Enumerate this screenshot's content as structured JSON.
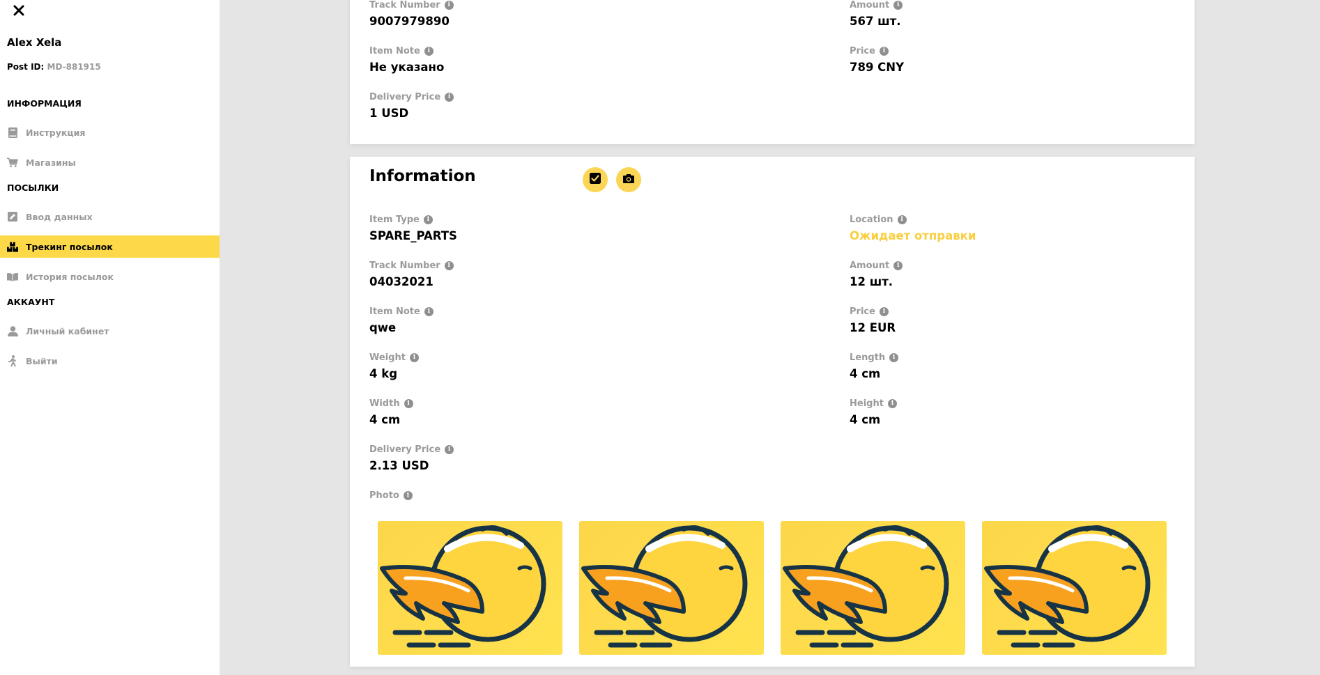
{
  "sidebar": {
    "close_icon": "close-icon",
    "user_name": "Alex Xela",
    "post_id_label": "Post ID:",
    "post_id_value": "MD-881915",
    "sections": {
      "info": "ИНФОРМАЦИЯ",
      "parcels": "ПОСЫЛКИ",
      "account": "АККАУНТ"
    },
    "items": {
      "instruction": {
        "label": "Инструкция",
        "icon": "book-icon"
      },
      "shops": {
        "label": "Магазины",
        "icon": "cart-icon"
      },
      "data_entry": {
        "label": "Ввод данных",
        "icon": "edit-icon"
      },
      "tracking": {
        "label": "Трекинг посылок",
        "icon": "boxes-icon",
        "active": true
      },
      "history": {
        "label": "История посылок",
        "icon": "open-book-icon"
      },
      "profile": {
        "label": "Личный кабинет",
        "icon": "user-icon"
      },
      "logout": {
        "label": "Выйти",
        "icon": "walk-icon"
      }
    }
  },
  "top_card": {
    "track_number": {
      "label": "Track Number",
      "value": "9007979890"
    },
    "amount": {
      "label": "Amount",
      "value": "567 шт."
    },
    "item_note": {
      "label": "Item Note",
      "value": "Не указано"
    },
    "price": {
      "label": "Price",
      "value": "789 CNY"
    },
    "delivery_price": {
      "label": "Delivery Price",
      "value": "1 USD"
    }
  },
  "info_card": {
    "title": "Information",
    "check_icon": "checkbox-icon",
    "camera_icon": "camera-icon",
    "item_type": {
      "label": "Item Type",
      "value": "SPARE_PARTS"
    },
    "location": {
      "label": "Location",
      "value": "Ожидает отправки"
    },
    "track_number": {
      "label": "Track Number",
      "value": "04032021"
    },
    "amount": {
      "label": "Amount",
      "value": "12 шт."
    },
    "item_note": {
      "label": "Item Note",
      "value": "qwe"
    },
    "price": {
      "label": "Price",
      "value": "12 EUR"
    },
    "weight": {
      "label": "Weight",
      "value": "4 kg"
    },
    "length": {
      "label": "Length",
      "value": "4 cm"
    },
    "width": {
      "label": "Width",
      "value": "4 cm"
    },
    "height": {
      "label": "Height",
      "value": "4 cm"
    },
    "delivery_price": {
      "label": "Delivery Price",
      "value": "2.13 USD"
    },
    "photo": {
      "label": "Photo"
    },
    "photos": [
      "bird-logo",
      "bird-logo",
      "bird-logo",
      "bird-logo"
    ]
  },
  "colors": {
    "accent": "#fdd94a",
    "location_status": "#f8cf3f",
    "muted_text": "#9a9a9a",
    "page_bg": "#e5e5e5"
  }
}
